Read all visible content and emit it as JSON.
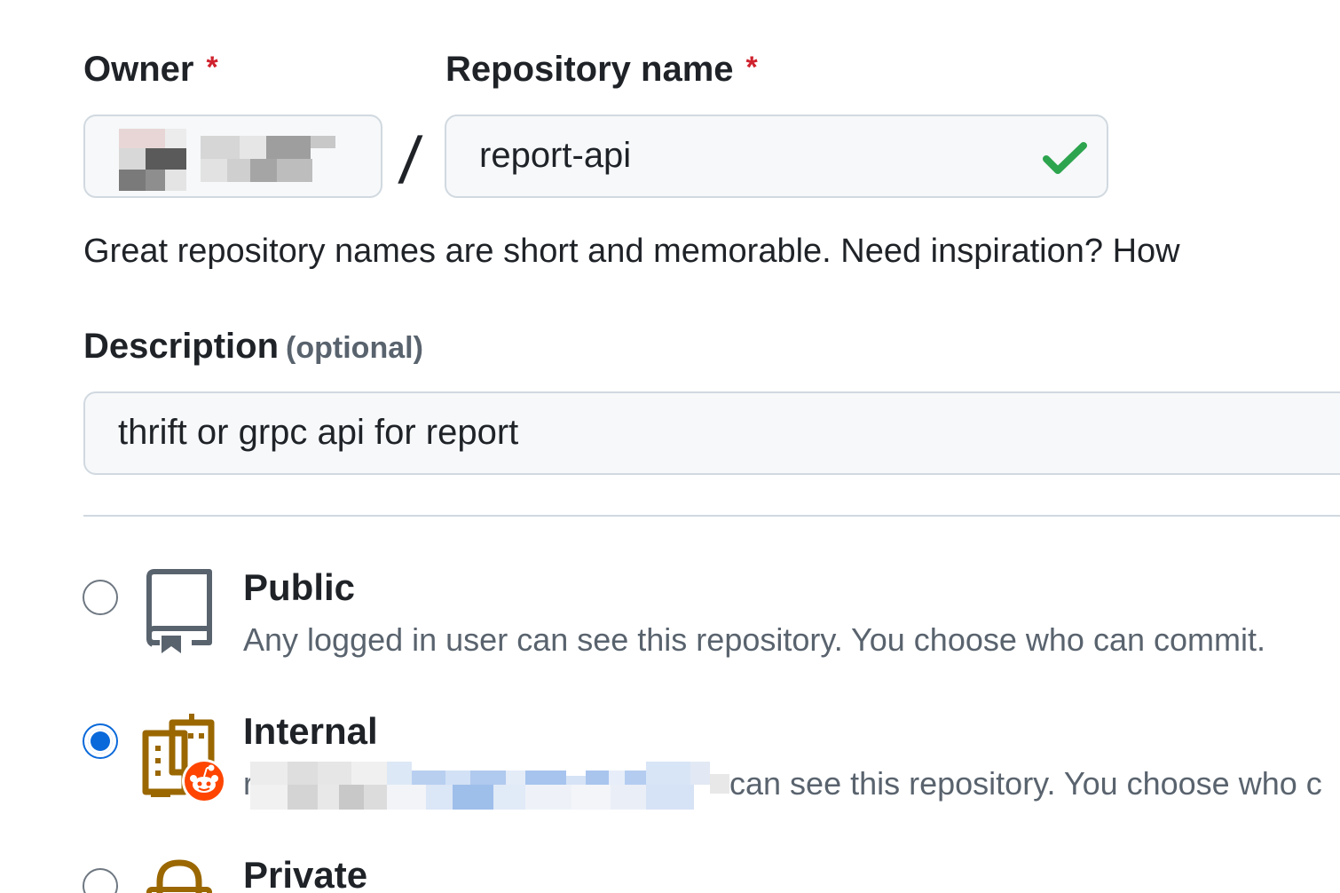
{
  "form": {
    "owner": {
      "label": "Owner",
      "required_mark": "*"
    },
    "repository_name": {
      "label": "Repository name",
      "required_mark": "*",
      "value": "report-api",
      "valid": true
    },
    "separator": "/",
    "hint": "Great repository names are short and memorable. Need inspiration? How",
    "description": {
      "label": "Description",
      "optional_label": "(optional)",
      "value": "thrift or grpc api for report"
    }
  },
  "visibility": {
    "selected": "internal",
    "options": [
      {
        "id": "public",
        "title": "Public",
        "description": "Any logged in user can see this repository. You choose who can commit.",
        "icon": "repo-book-icon"
      },
      {
        "id": "internal",
        "title": "Internal",
        "description_prefix": "r",
        "description_suffix": "can see this repository. You choose who c",
        "icon": "internal-building-icon"
      },
      {
        "id": "private",
        "title": "Private",
        "icon": "lock-icon"
      }
    ]
  },
  "colors": {
    "required": "#cf222e",
    "valid_check": "#2da44e",
    "radio_checked": "#0969da",
    "internal_icon": "#9a6700"
  }
}
